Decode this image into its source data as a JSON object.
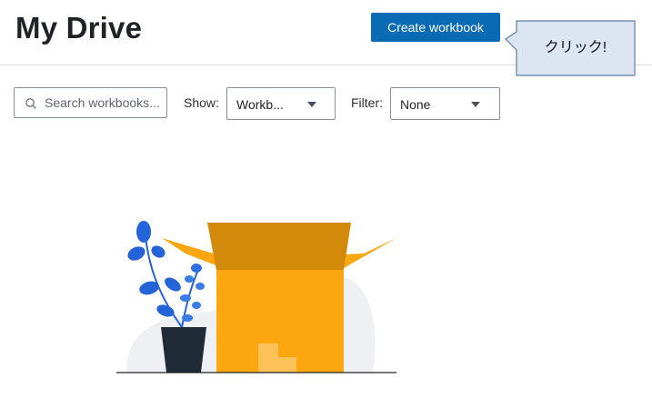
{
  "header": {
    "title": "My Drive",
    "create_label": "Create workbook"
  },
  "callout": {
    "text": "クリック!"
  },
  "toolbar": {
    "search_placeholder": "Search workbooks...",
    "show_label": "Show:",
    "show_value": "Workb...",
    "filter_label": "Filter:",
    "filter_value": "None"
  },
  "colors": {
    "primary_button": "#0a6bb5",
    "callout_fill": "#dce6f2",
    "box_orange": "#fca70f",
    "box_dark": "#d38a0a",
    "plant_blue": "#2563d9",
    "pot_dark": "#1e2a36"
  },
  "icons": {
    "search": "search-icon",
    "dropdown": "chevron-down-icon",
    "illustration": "empty-box-illustration"
  }
}
